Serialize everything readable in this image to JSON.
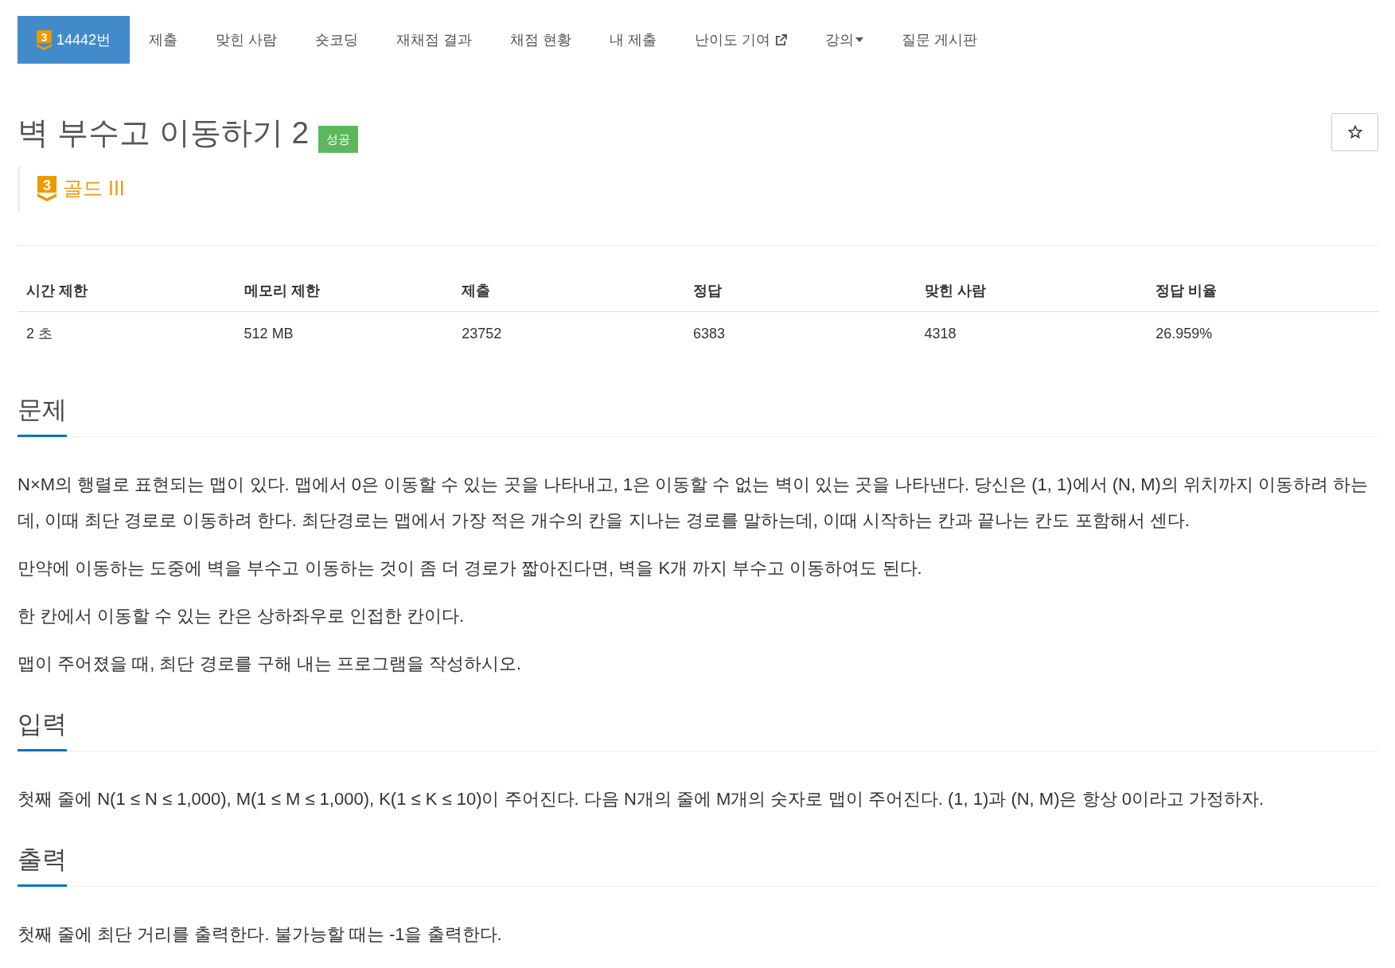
{
  "nav": {
    "tabs": [
      {
        "label": "14442번",
        "kind": "problem",
        "tier": {
          "level": "3",
          "kind": "gold"
        },
        "selected": true
      },
      {
        "label": "제출",
        "kind": "link",
        "selected": false
      },
      {
        "label": "맞힌 사람",
        "kind": "link",
        "selected": false
      },
      {
        "label": "숏코딩",
        "kind": "link",
        "selected": false
      },
      {
        "label": "재채점 결과",
        "kind": "link",
        "selected": false
      },
      {
        "label": "채점 현황",
        "kind": "link",
        "selected": false
      },
      {
        "label": "내 제출",
        "kind": "link",
        "selected": false
      },
      {
        "label": "난이도 기여",
        "kind": "external",
        "selected": false
      },
      {
        "label": "강의",
        "kind": "dropdown",
        "selected": false
      },
      {
        "label": "질문 게시판",
        "kind": "link",
        "selected": false
      }
    ]
  },
  "problem": {
    "title": "벽 부수고 이동하기 2",
    "result": {
      "label": "성공",
      "kind": "accepted"
    },
    "favorite": {
      "starred": false
    }
  },
  "tier": {
    "level": "3",
    "label": "골드 III",
    "kind": "gold"
  },
  "stats": {
    "columns": [
      "시간 제한",
      "메모리 제한",
      "제출",
      "정답",
      "맞힌 사람",
      "정답 비율"
    ],
    "rows": [
      [
        "2 초",
        "512 MB",
        "23752",
        "6383",
        "4318",
        "26.959%"
      ]
    ]
  },
  "sections": [
    {
      "heading": "문제",
      "paragraphs": [
        "N×M의 행렬로 표현되는 맵이 있다. 맵에서 0은 이동할 수 있는 곳을 나타내고, 1은 이동할 수 없는 벽이 있는 곳을 나타낸다. 당신은 (1, 1)에서 (N, M)의 위치까지 이동하려 하는데, 이때 최단 경로로 이동하려 한다. 최단경로는 맵에서 가장 적은 개수의 칸을 지나는 경로를 말하는데, 이때 시작하는 칸과 끝나는 칸도 포함해서 센다.",
        "만약에 이동하는 도중에 벽을 부수고 이동하는 것이 좀 더 경로가 짧아진다면, 벽을 K개 까지 부수고 이동하여도 된다.",
        "한 칸에서 이동할 수 있는 칸은 상하좌우로 인접한 칸이다.",
        "맵이 주어졌을 때, 최단 경로를 구해 내는 프로그램을 작성하시오."
      ]
    },
    {
      "heading": "입력",
      "paragraphs": [
        "첫째 줄에 N(1 ≤ N ≤ 1,000), M(1 ≤ M ≤ 1,000), K(1 ≤ K ≤ 10)이 주어진다. 다음 N개의 줄에 M개의 숫자로 맵이 주어진다. (1, 1)과 (N, M)은 항상 0이라고 가정하자."
      ]
    },
    {
      "heading": "출력",
      "paragraphs": [
        "첫째 줄에 최단 거리를 출력한다. 불가능할 때는 -1을 출력한다."
      ]
    }
  ]
}
